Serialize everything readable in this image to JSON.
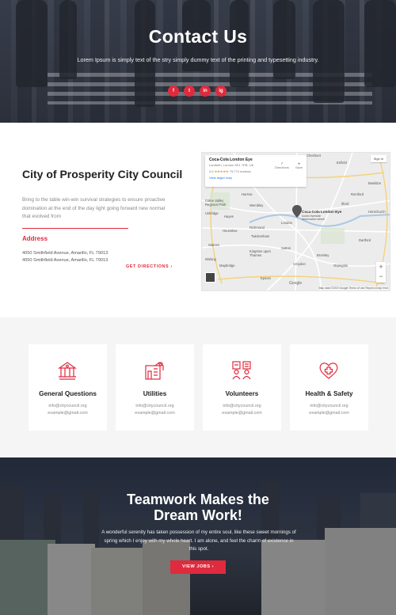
{
  "hero": {
    "title": "Contact Us",
    "subtitle": "Lorem Ipsum is simply text of the stry simply dummy text of the printing and typesetting industry.",
    "social": [
      "f",
      "t",
      "in",
      "ig"
    ]
  },
  "council": {
    "title": "City of Prosperity City Council",
    "description": "Bring to the table win-win survival strategies to ensure proactive domination at the end of the day light going forward new normal that evolved from",
    "address_heading": "Address",
    "address_lines": [
      "4050 Smithfield Avenue, Amarillo, FL 79013",
      "4050 Smithfield Avenue, Amarillo, FL 79013"
    ],
    "cta": "GET DIRECTIONS ›"
  },
  "map": {
    "place": "Coca-Cola London Eye",
    "place_addr": "Lambeth, London SE1 7PB, UK",
    "rating": "4.5",
    "reviews": "79,774 reviews",
    "larger_link": "View larger map",
    "directions": "Directions",
    "save": "Save",
    "sign_in": "Sign in",
    "pin_label": "Coca-Cola London Eye",
    "pin_sub": "Iconic riverside observation wheel",
    "google": "Google",
    "footer": "Map data ©2019 Google   Terms of Use   Report a map error",
    "labels": [
      "Cheshunt",
      "Enfield",
      "Harrow",
      "Wembley",
      "Hayes",
      "Romford",
      "Ilford",
      "Colne Valley Regional Park",
      "Uxbridge",
      "Twickenham",
      "Richmond",
      "Kingston upon Thames",
      "Croydon",
      "Bromley",
      "Dartford",
      "Orpington",
      "Epsom",
      "Maybridge",
      "Staines",
      "Woking",
      "Hornchurch",
      "Basildon",
      "London",
      "Hounslow",
      "Sutton"
    ]
  },
  "cards": [
    {
      "title": "General Questions",
      "email1": "info@citycouncil.org",
      "email2": "example@gmail.com"
    },
    {
      "title": "Utilities",
      "email1": "info@citycouncil.org",
      "email2": "example@gmail.com"
    },
    {
      "title": "Volunteers",
      "email1": "info@citycouncil.org",
      "email2": "example@gmail.com"
    },
    {
      "title": "Health & Safety",
      "email1": "info@citycouncil.org",
      "email2": "example@gmail.com"
    }
  ],
  "teamwork": {
    "title_line1": "Teamwork Makes the",
    "title_line2": "Dream Work!",
    "text": "A wonderful serenity has taken possession of my entire soul, like these sweet mornings of spring which I enjoy with my whole heart. I am alone, and feel the charm of existence in this spot.",
    "cta": "VIEW JOBS ›"
  },
  "colors": {
    "accent": "#e02a3d"
  }
}
